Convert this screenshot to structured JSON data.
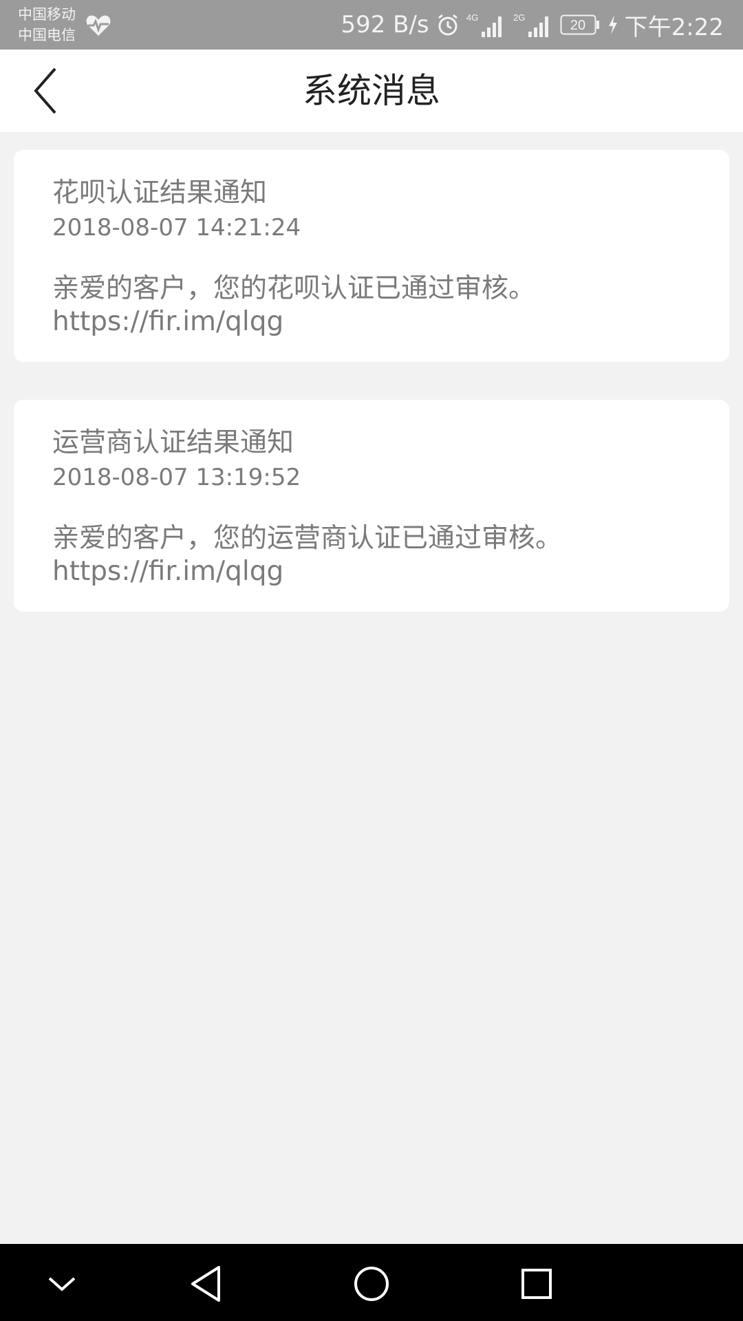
{
  "status_bar": {
    "carrier_1": "中国移动",
    "carrier_2": "中国电信",
    "net_speed": "592 B/s",
    "signal_1_label": "4G",
    "signal_2_label": "2G",
    "battery": "20",
    "time": "下午2:22"
  },
  "header": {
    "title": "系统消息"
  },
  "messages": [
    {
      "title": "花呗认证结果通知",
      "time": "2018-08-07 14:21:24",
      "body": "亲爱的客户，您的花呗认证已通过审核。",
      "link": "https://fir.im/qlqg"
    },
    {
      "title": "运营商认证结果通知",
      "time": "2018-08-07 13:19:52",
      "body": "亲爱的客户，您的运营商认证已通过审核。",
      "link": "https://fir.im/qlqg"
    }
  ],
  "nav_bar": {
    "icons": [
      "chevron-down-icon",
      "back-triangle-icon",
      "home-circle-icon",
      "recents-square-icon"
    ]
  },
  "colors": {
    "status_bar_bg": "#9b9b9b",
    "page_bg": "#f2f2f2",
    "card_bg": "#ffffff",
    "text_gray": "#7a7a7a",
    "nav_bar_bg": "#000000"
  }
}
